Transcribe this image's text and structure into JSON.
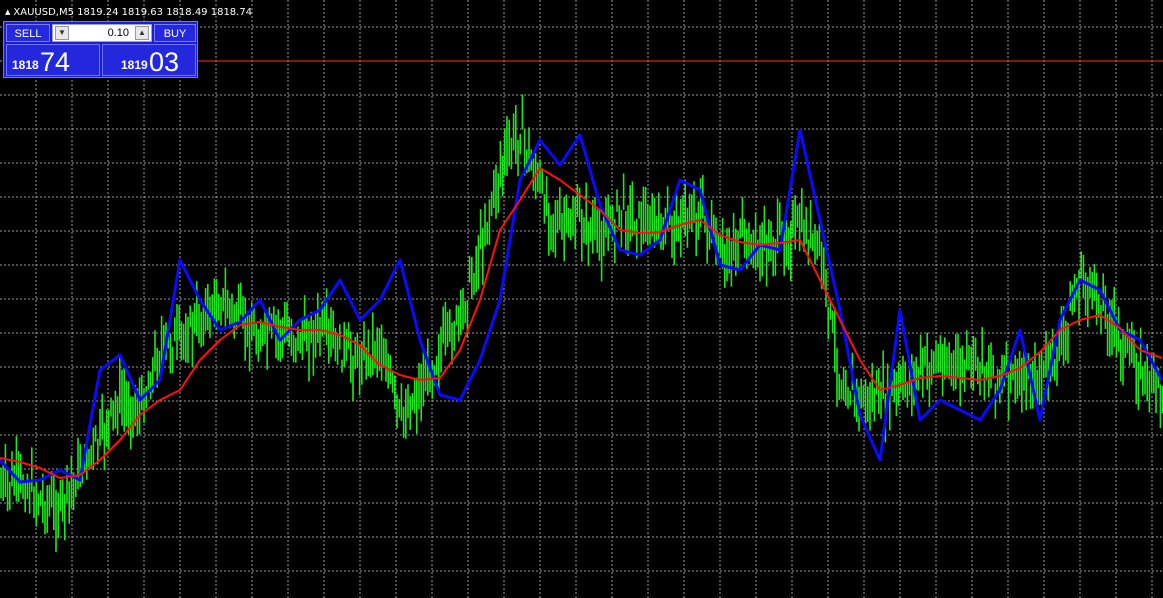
{
  "window": {
    "title": "XAUUSD,M5",
    "ohlc": "1819.24 1819.63 1818.49 1818.74"
  },
  "trade_panel": {
    "sell_label": "SELL",
    "buy_label": "BUY",
    "lot_size": "0.10",
    "bid": {
      "prefix": "1818",
      "pips": "74"
    },
    "ask": {
      "prefix": "1819",
      "pips": "03"
    }
  },
  "colors": {
    "background": "#000000",
    "grid": "#c0c0c0",
    "candles": "#00e000",
    "moving_average": "#ff0000",
    "indicator": "#0000ff",
    "bid_line": "#ff0000"
  },
  "chart_data": {
    "type": "line",
    "symbol": "XAUUSD",
    "timeframe": "M5",
    "current_price": 1818.74,
    "grid": true,
    "x": [
      0,
      20,
      40,
      60,
      80,
      100,
      120,
      140,
      160,
      180,
      200,
      220,
      240,
      260,
      280,
      300,
      320,
      340,
      360,
      380,
      400,
      420,
      440,
      460,
      480,
      500,
      520,
      540,
      560,
      580,
      600,
      620,
      640,
      660,
      680,
      700,
      720,
      740,
      760,
      780,
      800,
      820,
      840,
      860,
      880,
      900,
      920,
      940,
      960,
      980,
      1000,
      1020,
      1040,
      1060,
      1080,
      1100,
      1120,
      1140,
      1162
    ],
    "series": [
      {
        "values": [
          490,
          480,
          500,
          510,
          470,
          440,
          400,
          410,
          350,
          340,
          320,
          300,
          320,
          340,
          330,
          340,
          330,
          350,
          360,
          340,
          420,
          390,
          350,
          320,
          250,
          170,
          130,
          190,
          230,
          220,
          240,
          210,
          220,
          230,
          220,
          210,
          260,
          240,
          250,
          240,
          230,
          250,
          380,
          400,
          400,
          390,
          370,
          360,
          370,
          360,
          380,
          380,
          380,
          350,
          280,
          300,
          340,
          370,
          390
        ]
      },
      {
        "values": [
          458,
          462,
          468,
          478,
          475,
          460,
          440,
          415,
          400,
          390,
          360,
          340,
          325,
          322,
          327,
          330,
          330,
          335,
          345,
          365,
          375,
          380,
          378,
          350,
          300,
          230,
          200,
          168,
          180,
          195,
          210,
          230,
          233,
          232,
          225,
          220,
          235,
          242,
          245,
          243,
          240,
          280,
          320,
          360,
          390,
          385,
          378,
          376,
          378,
          380,
          376,
          368,
          352,
          330,
          320,
          315,
          328,
          350,
          358
        ]
      },
      {
        "values": [
          460,
          482,
          480,
          470,
          480,
          370,
          355,
          400,
          380,
          260,
          300,
          330,
          322,
          300,
          340,
          320,
          310,
          280,
          320,
          300,
          260,
          340,
          395,
          400,
          360,
          300,
          180,
          140,
          165,
          135,
          205,
          250,
          255,
          240,
          180,
          190,
          265,
          270,
          245,
          250,
          130,
          220,
          310,
          415,
          460,
          310,
          420,
          400,
          410,
          420,
          390,
          330,
          420,
          320,
          280,
          290,
          330,
          340,
          380
        ]
      }
    ]
  }
}
